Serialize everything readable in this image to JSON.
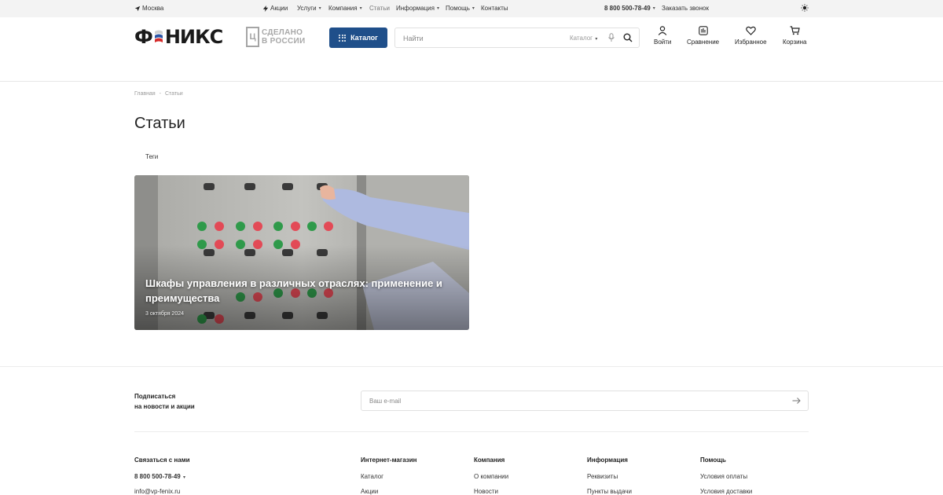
{
  "topbar": {
    "city": "Москва",
    "nav": [
      {
        "label": "Акции",
        "has_dropdown": false,
        "icon": "bolt-icon"
      },
      {
        "label": "Услуги",
        "has_dropdown": true
      },
      {
        "label": "Компания",
        "has_dropdown": true
      },
      {
        "label": "Статьи",
        "has_dropdown": false
      },
      {
        "label": "Информация",
        "has_dropdown": true
      },
      {
        "label": "Помощь",
        "has_dropdown": true
      },
      {
        "label": "Контакты",
        "has_dropdown": false
      }
    ],
    "phone": "8 800 500-78-49",
    "callback": "Заказать звонок",
    "theme_icon": "sun-icon"
  },
  "header": {
    "logo_text_left": "Ф",
    "logo_text_right": "НИКС",
    "made_in_box": "Ц",
    "made_in_line1": "СДЕЛАНО",
    "made_in_line2": "В РОССИИ",
    "catalog_label": "Каталог",
    "search_placeholder": "Найти",
    "search_scope": "Каталог",
    "icons": [
      {
        "label": "Войти",
        "icon": "user-icon"
      },
      {
        "label": "Сравнение",
        "icon": "compare-icon"
      },
      {
        "label": "Избранное",
        "icon": "heart-icon"
      },
      {
        "label": "Корзина",
        "icon": "cart-icon"
      }
    ]
  },
  "breadcrumb": {
    "home": "Главная",
    "current": "Статьи"
  },
  "page": {
    "title": "Статьи",
    "tags_label": "Теги"
  },
  "articles": [
    {
      "title": "Шкафы управления в различных отраслях: применение и преимущества",
      "date": "3 октября 2024"
    }
  ],
  "footer": {
    "subscribe_line1": "Подписаться",
    "subscribe_line2": "на новости и акции",
    "email_placeholder": "Ваш e-mail",
    "contact": {
      "heading": "Связаться с нами",
      "phone": "8 800 500-78-49",
      "email": "info@vp-fenix.ru"
    },
    "columns": [
      {
        "heading": "Интернет-магазин",
        "links": [
          "Каталог",
          "Акции"
        ]
      },
      {
        "heading": "Компания",
        "links": [
          "О компании",
          "Новости"
        ]
      },
      {
        "heading": "Информация",
        "links": [
          "Реквизиты",
          "Пункты выдачи"
        ]
      },
      {
        "heading": "Помощь",
        "links": [
          "Условия оплаты",
          "Условия доставки"
        ]
      }
    ]
  },
  "colors": {
    "accent": "#1f4f8a",
    "topbar_bg": "#f3f3f3",
    "border": "#e6e6e6"
  }
}
